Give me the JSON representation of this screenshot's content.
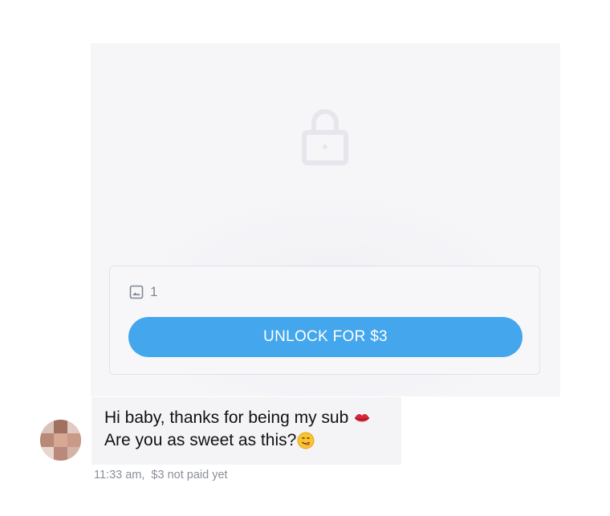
{
  "locked_post": {
    "media_count": "1",
    "unlock_label": "UNLOCK FOR $3"
  },
  "message": {
    "line1": "Hi baby, thanks for being my sub",
    "line2": "Are you as sweet as this?",
    "line1_emoji": "kiss-lips-emoji",
    "line2_emoji": "yum-face-emoji"
  },
  "meta": {
    "time": "11:33 am,",
    "price_status": "$3 not paid yet"
  },
  "colors": {
    "accent": "#44a6ec",
    "panel_bg": "#f6f6f9",
    "meta_text": "#8a8f99"
  }
}
